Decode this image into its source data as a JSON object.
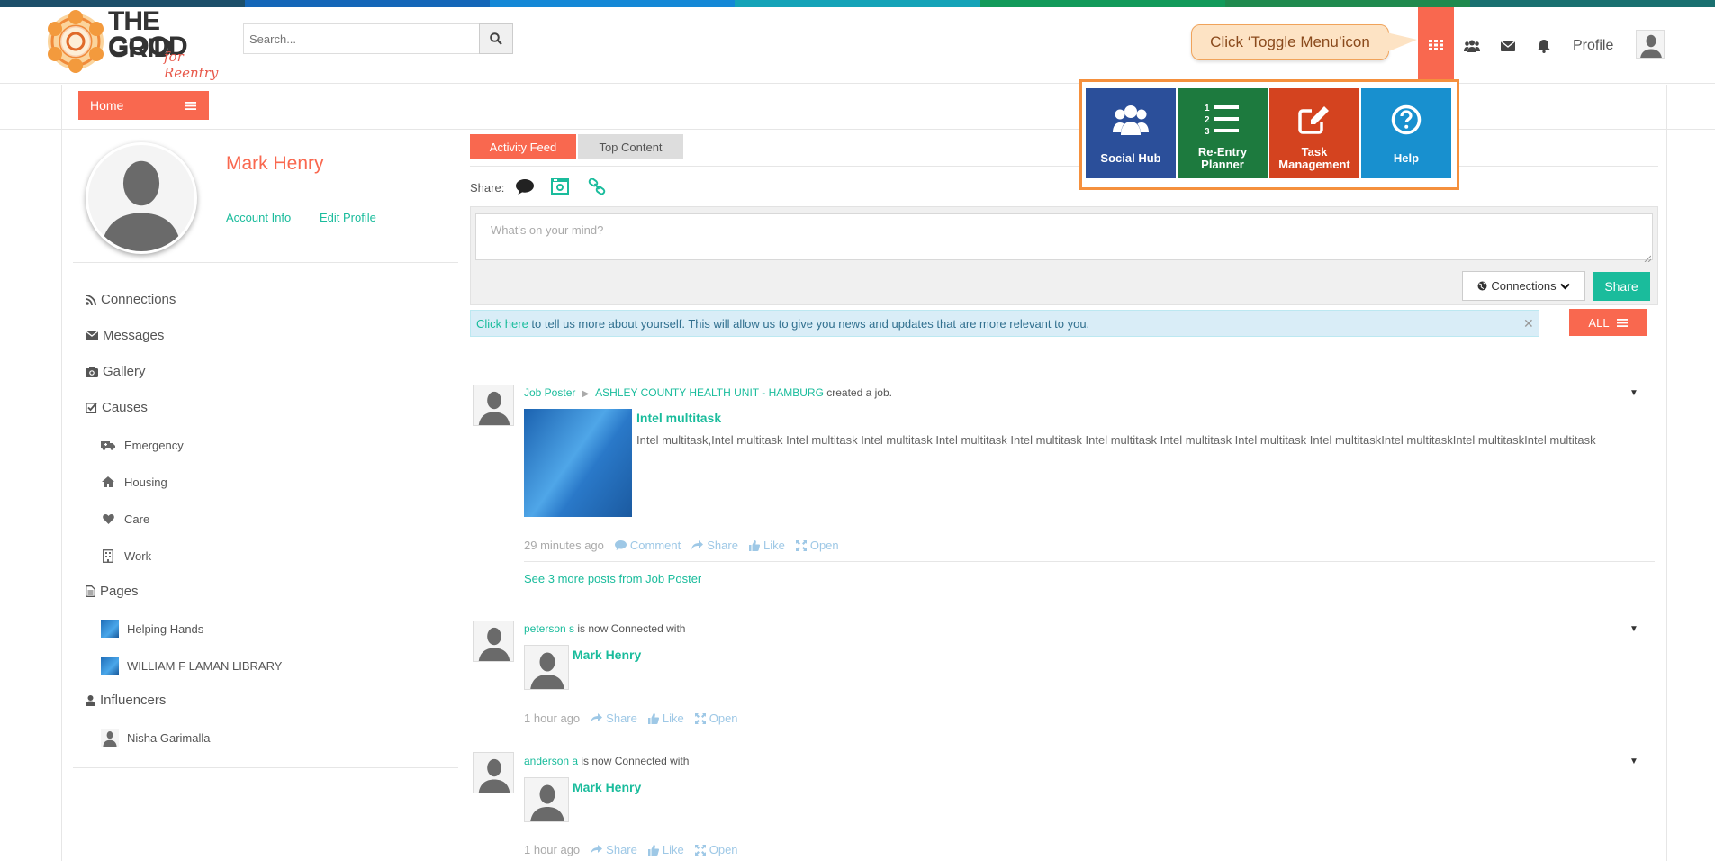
{
  "colors": {
    "strip": [
      "#1c4f6a",
      "#1466b8",
      "#1488d6",
      "#15a3b8",
      "#129a5a",
      "#1f8a4e",
      "#1a7070"
    ],
    "accent": "#f9684f",
    "teal": "#1abc9c",
    "callout_border": "#f0a35a",
    "tile_social": "#2b4f9a",
    "tile_planner": "#1d7a3e",
    "tile_task": "#d4431f",
    "tile_help": "#1890cf"
  },
  "header": {
    "logo_line1": "THE GOOD",
    "logo_line2": "GRID",
    "logo_tagline": "for Reentry",
    "search_placeholder": "Search...",
    "callout_text": "Click ‘Toggle Menu’icon",
    "profile_label": "Profile",
    "icons": [
      "grid-icon",
      "users-icon",
      "envelope-icon",
      "bell-icon"
    ]
  },
  "subnav": {
    "home_label": "Home"
  },
  "toggle_menu": {
    "tiles": [
      {
        "line1": "Social Hub",
        "line2": "",
        "icon": "users-icon"
      },
      {
        "line1": "Re-Entry",
        "line2": "Planner",
        "icon": "numbered-list-icon"
      },
      {
        "line1": "Task",
        "line2": "Management",
        "icon": "edit-icon"
      },
      {
        "line1": "Help",
        "line2": "",
        "icon": "question-icon"
      }
    ]
  },
  "sidebar": {
    "user_name": "Mark Henry",
    "account_info": "Account Info",
    "edit_profile": "Edit Profile",
    "connections": "Connections",
    "messages": "Messages",
    "gallery": "Gallery",
    "causes": "Causes",
    "cause_items": [
      "Emergency",
      "Housing",
      "Care",
      "Work"
    ],
    "pages": "Pages",
    "page_items": [
      "Helping Hands",
      "WILLIAM F LAMAN LIBRARY"
    ],
    "influencers": "Influencers",
    "influencer_items": [
      "Nisha Garimalla"
    ]
  },
  "center": {
    "tab_activity": "Activity Feed",
    "tab_top": "Top Content",
    "share_label": "Share:",
    "textarea_placeholder": "What's on your mind?",
    "connections_btn": "Connections",
    "share_btn": "Share",
    "info_link": "Click here",
    "info_text": " to tell us more about yourself. This will allow us to give you news and updates that are more relevant to you.",
    "all_btn": "ALL"
  },
  "feed": {
    "post1": {
      "author": "Job Poster",
      "target": "ASHLEY COUNTY HEALTH UNIT - HAMBURG",
      "action": " created a job.",
      "title": "Intel multitask",
      "desc": "Intel multitask,Intel multitask Intel multitask Intel multitask Intel multitask Intel multitask Intel multitask Intel multitask Intel multitask  Intel multitaskIntel multitaskIntel multitaskIntel multitask",
      "time": "29 minutes ago",
      "comment": "Comment",
      "share": "Share",
      "like": "Like",
      "open": "Open",
      "more": "See 3 more posts from Job Poster"
    },
    "post2": {
      "author": "peterson s",
      "action": " is now Connected with",
      "connected": "Mark Henry",
      "time": "1 hour ago",
      "share": "Share",
      "like": "Like",
      "open": "Open"
    },
    "post3": {
      "author": "anderson a",
      "action": " is now Connected with",
      "connected": "Mark Henry",
      "time": "1 hour ago",
      "share": "Share",
      "like": "Like",
      "open": "Open"
    }
  }
}
